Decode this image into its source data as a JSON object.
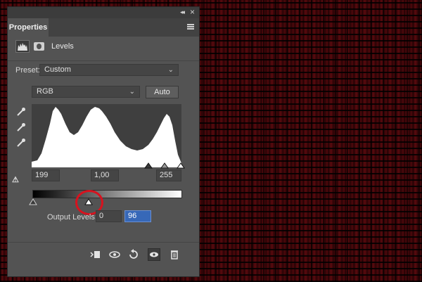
{
  "panel": {
    "tab_label": "Properties",
    "collapse_glyph": "◂◂",
    "close_glyph": "×",
    "adjustment_title": "Levels"
  },
  "preset": {
    "label": "Preset:",
    "value": "Custom"
  },
  "channel": {
    "value": "RGB",
    "auto_label": "Auto"
  },
  "input_levels": {
    "black": "199",
    "gamma": "1,00",
    "white": "255"
  },
  "output_levels": {
    "label": "Output Levels:",
    "black": "0",
    "white": "96"
  },
  "footer": {
    "icons": [
      "clip-to-layer-icon",
      "view-previous-state-icon",
      "reset-icon",
      "visibility-eye-icon",
      "trash-icon"
    ]
  },
  "colors": {
    "panel_bg": "#535353",
    "highlight_ring": "#d8121e",
    "active_field": "#3768b8",
    "background_brick": "#4e080c"
  }
}
